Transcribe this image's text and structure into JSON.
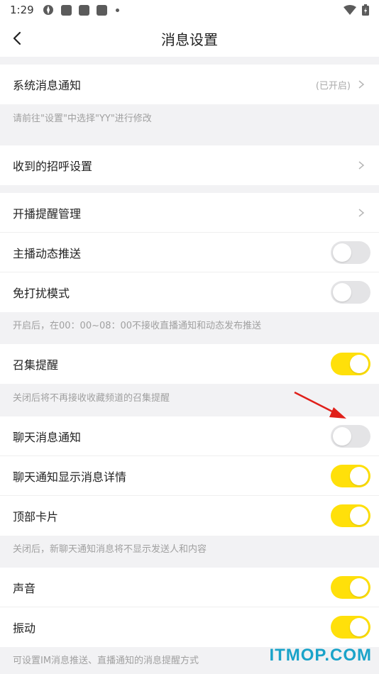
{
  "status_bar": {
    "time": "1:29"
  },
  "header": {
    "title": "消息设置"
  },
  "sections": {
    "system_notification": {
      "label": "系统消息通知",
      "status": "(已开启)"
    },
    "note_system": "请前往\"设置\"中选择\"YY\"进行修改",
    "greeting_settings": {
      "label": "收到的招呼设置"
    },
    "broadcast_reminder": {
      "label": "开播提醒管理"
    },
    "anchor_push": {
      "label": "主播动态推送",
      "on": false
    },
    "dnd_mode": {
      "label": "免打扰模式",
      "on": false
    },
    "note_dnd": "开启后，在00：00~08：00不接收直播通知和动态发布推送",
    "gather_reminder": {
      "label": "召集提醒",
      "on": true
    },
    "note_gather": "关闭后将不再接收收藏频道的召集提醒",
    "chat_notification": {
      "label": "聊天消息通知",
      "on": false
    },
    "chat_details": {
      "label": "聊天通知显示消息详情",
      "on": true
    },
    "top_card": {
      "label": "顶部卡片",
      "on": true
    },
    "note_chat": "关闭后，新聊天通知消息将不显示发送人和内容",
    "sound": {
      "label": "声音",
      "on": true
    },
    "vibration": {
      "label": "振动",
      "on": true
    },
    "note_footer": "可设置IM消息推送、直播通知的消息提醒方式"
  },
  "watermark": "ITMOP.COM",
  "colors": {
    "toggle_on": "#ffe00a",
    "toggle_off": "#e4e4e6",
    "background": "#f2f2f4",
    "annotation_arrow": "#e0201a"
  }
}
